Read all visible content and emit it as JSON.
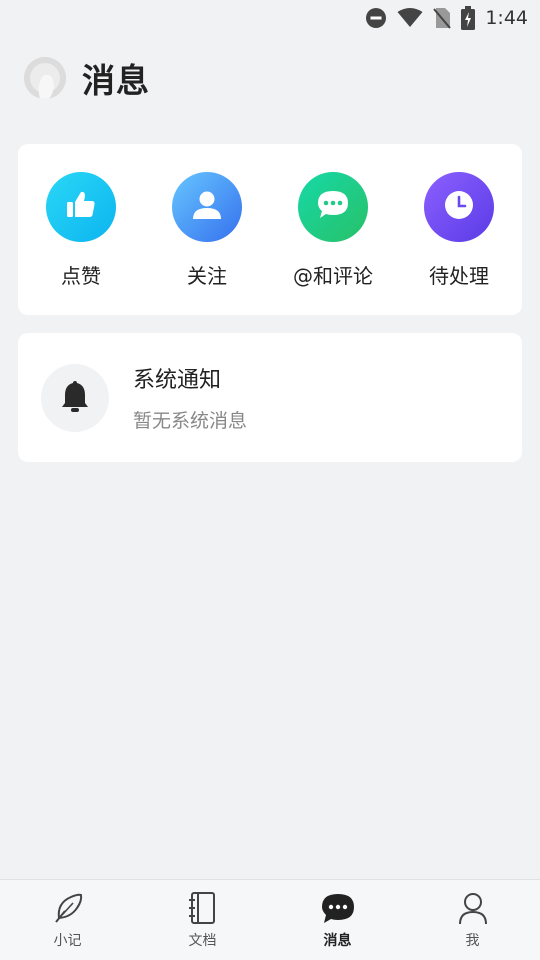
{
  "status_bar": {
    "time": "1:44"
  },
  "header": {
    "title": "消息"
  },
  "quick_actions": [
    {
      "label": "点赞",
      "icon": "thumbs-up-icon",
      "color_from": "#25d5f5",
      "color_to": "#0fb6f0"
    },
    {
      "label": "关注",
      "icon": "user-icon",
      "color_from": "#60b8ff",
      "color_to": "#3a78f0"
    },
    {
      "label": "@和评论",
      "icon": "chat-icon",
      "color_from": "#18d6a0",
      "color_to": "#27c36c"
    },
    {
      "label": "待处理",
      "icon": "clock-icon",
      "color_from": "#8a5cff",
      "color_to": "#5b3de6"
    }
  ],
  "system_notice": {
    "title": "系统通知",
    "subtitle": "暂无系统消息",
    "icon": "bell-icon"
  },
  "tabs": [
    {
      "label": "小记",
      "icon": "feather-icon",
      "active": false
    },
    {
      "label": "文档",
      "icon": "notebook-icon",
      "active": false
    },
    {
      "label": "消息",
      "icon": "message-icon",
      "active": true
    },
    {
      "label": "我",
      "icon": "person-icon",
      "active": false
    }
  ],
  "colors": {
    "background": "#f1f2f4",
    "card": "#ffffff",
    "text": "#222222",
    "muted": "#888888"
  }
}
